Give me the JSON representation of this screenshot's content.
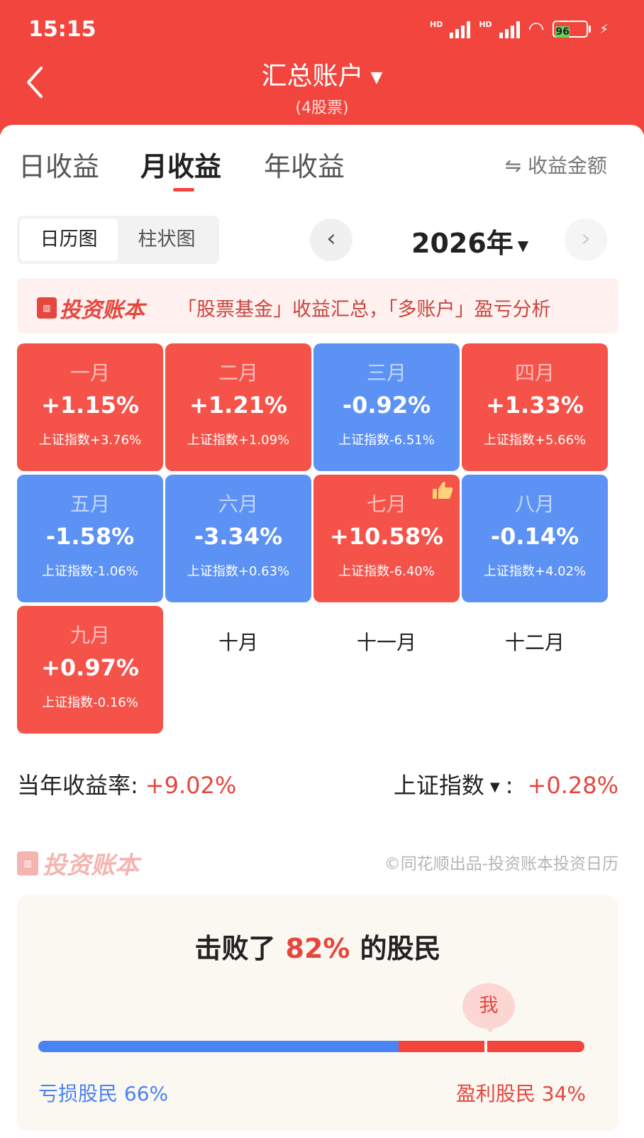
{
  "status_bar": {
    "time": "15:15",
    "hd1": "HD",
    "hd2": "HD",
    "battery": "96"
  },
  "header": {
    "title": "汇总账户",
    "subtitle": "(4股票)"
  },
  "tabs": [
    {
      "label": "日收益",
      "active": false
    },
    {
      "label": "月收益",
      "active": true
    },
    {
      "label": "年收益",
      "active": false
    }
  ],
  "income_toggle": "⇋ 收益金额",
  "view_toggle": [
    {
      "label": "日历图",
      "active": true
    },
    {
      "label": "柱状图",
      "active": false
    }
  ],
  "year_selector": {
    "year": "2026年"
  },
  "banner": {
    "logo": "投资账本",
    "text": "「股票基金」收益汇总，「多账户」盈亏分析"
  },
  "months": [
    {
      "month": "一月",
      "return": "+1.15%",
      "index": "上证指数+3.76%",
      "color": "red"
    },
    {
      "month": "二月",
      "return": "+1.21%",
      "index": "上证指数+1.09%",
      "color": "red"
    },
    {
      "month": "三月",
      "return": "-0.92%",
      "index": "上证指数-6.51%",
      "color": "blue"
    },
    {
      "month": "四月",
      "return": "+1.33%",
      "index": "上证指数+5.66%",
      "color": "red"
    },
    {
      "month": "五月",
      "return": "-1.58%",
      "index": "上证指数-1.06%",
      "color": "blue"
    },
    {
      "month": "六月",
      "return": "-3.34%",
      "index": "上证指数+0.63%",
      "color": "blue"
    },
    {
      "month": "七月",
      "return": "+10.58%",
      "index": "上证指数-6.40%",
      "color": "red",
      "icon": "thumbs-up-icon"
    },
    {
      "month": "八月",
      "return": "-0.14%",
      "index": "上证指数+4.02%",
      "color": "blue"
    },
    {
      "month": "九月",
      "return": "+0.97%",
      "index": "上证指数-0.16%",
      "color": "red"
    },
    {
      "month": "十月"
    },
    {
      "month": "十一月"
    },
    {
      "month": "十二月"
    }
  ],
  "summary": {
    "yearly_label": "当年收益率:",
    "yearly_value": "+9.02%",
    "index_label": "上证指数",
    "index_colon": ":",
    "index_value": "+0.28%"
  },
  "watermark": {
    "logo": "投资账本",
    "copyright": "©同花顺出品-投资账本投资日历"
  },
  "beat": {
    "prefix": "击败了",
    "percent": "82%",
    "suffix": "的股民",
    "me_label": "我",
    "loss_label": "亏损股民 66%",
    "profit_label": "盈利股民 34%",
    "loss_share": 0.66,
    "me_position": 0.82
  },
  "colors": {
    "brand_red": "#f2453d",
    "gain_red": "#f5524a",
    "loss_blue": "#5d92f5",
    "bar_blue": "#4a83f3"
  }
}
